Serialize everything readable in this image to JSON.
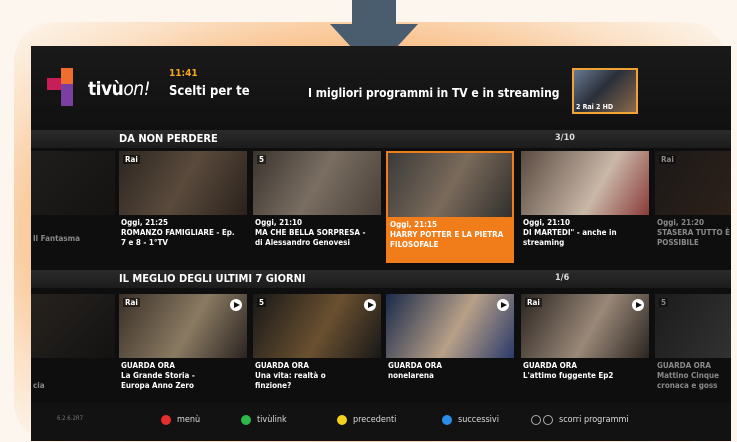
{
  "header": {
    "logo": "tivù",
    "logo_on": "on!",
    "clock": "11:41",
    "title": "Scelti per te",
    "subtitle": "I migliori programmi in TV e in streaming",
    "preview_label": "2 Rai 2 HD"
  },
  "section1": {
    "title": "DA NON PERDERE",
    "count": "3/10",
    "tiles": [
      {
        "channel": "",
        "line1": "",
        "line2": "Il Fantasma",
        "line3": ""
      },
      {
        "channel": "Rai",
        "line1": "Oggi,  21:25",
        "line2": "ROMANZO FAMIGLIARE - Ep.",
        "line3": "7 e 8 - 1°TV"
      },
      {
        "channel": "5",
        "line1": "Oggi,  21:10",
        "line2": "MA CHE BELLA SORPRESA -",
        "line3": "di Alessandro Genovesi"
      },
      {
        "channel": "",
        "line1": "Oggi,  21:15",
        "line2": "HARRY POTTER E LA PIETRA",
        "line3": "FILOSOFALE"
      },
      {
        "channel": "",
        "line1": "Oggi,  21:10",
        "line2": "DI MARTEDI\" - anche in",
        "line3": "streaming"
      },
      {
        "channel": "Rai",
        "line1": "Oggi,  21:20",
        "line2": "STASERA TUTTO È",
        "line3": "POSSIBILE"
      }
    ]
  },
  "section2": {
    "title": "IL MEGLIO DEGLI ULTIMI 7 GIORNI",
    "count": "1/6",
    "tiles": [
      {
        "channel": "",
        "line1": "",
        "line2": "cia",
        "line3": ""
      },
      {
        "channel": "Rai",
        "line1": "GUARDA ORA",
        "line2": "La Grande Storia -",
        "line3": "Europa Anno Zero"
      },
      {
        "channel": "5",
        "line1": "GUARDA ORA",
        "line2": "Una vita: realtà o",
        "line3": "finzione?"
      },
      {
        "channel": "",
        "line1": "GUARDA ORA",
        "line2": "nonelarena",
        "line3": ""
      },
      {
        "channel": "Rai",
        "line1": "GUARDA ORA",
        "line2": "L'attimo fuggente Ep2",
        "line3": ""
      },
      {
        "channel": "5",
        "line1": "GUARDA ORA",
        "line2": "Mattino Cinque",
        "line3": "cronaca e goss"
      }
    ]
  },
  "footer": {
    "version": "6.2.6.2R7",
    "menu": "menù",
    "tivulink": "tivùlink",
    "prev": "precedenti",
    "next": "successivi",
    "scroll": "scorri programmi"
  },
  "colors": {
    "accent": "#f07d1a",
    "red": "#e62e2e",
    "green": "#2fb84a",
    "yellow": "#f2d21a",
    "blue": "#2a8ee8"
  }
}
